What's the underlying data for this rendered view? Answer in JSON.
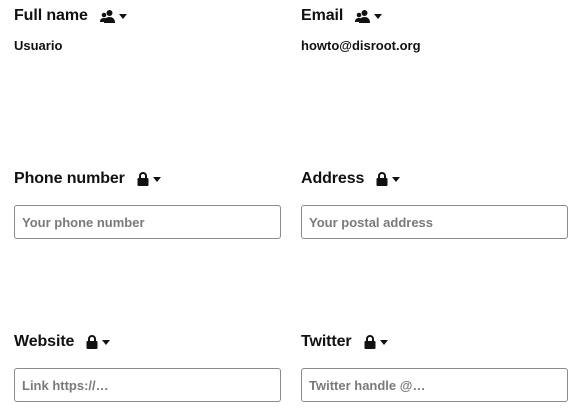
{
  "fields": {
    "fullname": {
      "label": "Full name",
      "value": "Usuario",
      "scope_icon": "contacts-icon"
    },
    "email": {
      "label": "Email",
      "value": "howto@disroot.org",
      "scope_icon": "contacts-icon"
    },
    "phone": {
      "label": "Phone number",
      "placeholder": "Your phone number",
      "value": "",
      "scope_icon": "lock-icon"
    },
    "address": {
      "label": "Address",
      "placeholder": "Your postal address",
      "value": "",
      "scope_icon": "lock-icon"
    },
    "website": {
      "label": "Website",
      "placeholder": "Link https://…",
      "value": "",
      "scope_icon": "lock-icon"
    },
    "twitter": {
      "label": "Twitter",
      "placeholder": "Twitter handle @…",
      "value": "",
      "scope_icon": "lock-icon"
    }
  }
}
